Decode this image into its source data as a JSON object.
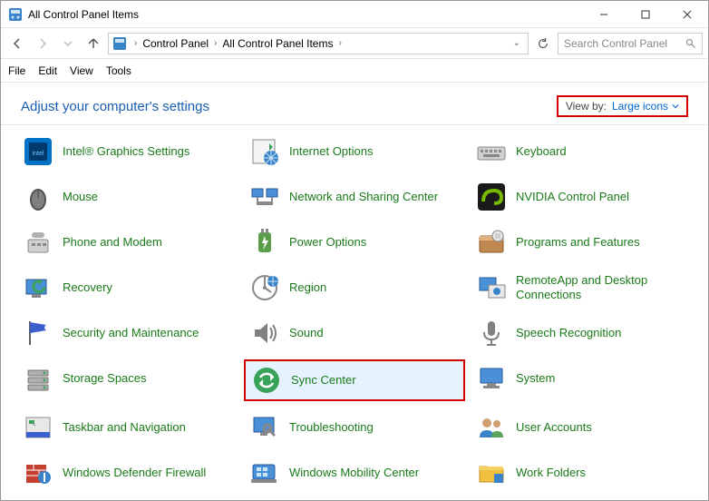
{
  "window": {
    "title": "All Control Panel Items"
  },
  "breadcrumb": {
    "part1": "Control Panel",
    "part2": "All Control Panel Items"
  },
  "search": {
    "placeholder": "Search Control Panel"
  },
  "menus": {
    "file": "File",
    "edit": "Edit",
    "view": "View",
    "tools": "Tools"
  },
  "header": {
    "title": "Adjust your computer's settings"
  },
  "viewby": {
    "label": "View by:",
    "value": "Large icons"
  },
  "items": {
    "intel_graphics": "Intel® Graphics Settings",
    "internet_options": "Internet Options",
    "keyboard": "Keyboard",
    "mouse": "Mouse",
    "network_sharing": "Network and Sharing Center",
    "nvidia": "NVIDIA Control Panel",
    "phone_modem": "Phone and Modem",
    "power_options": "Power Options",
    "programs_features": "Programs and Features",
    "recovery": "Recovery",
    "region": "Region",
    "remoteapp": "RemoteApp and Desktop Connections",
    "security_maintenance": "Security and Maintenance",
    "sound": "Sound",
    "speech_recognition": "Speech Recognition",
    "storage_spaces": "Storage Spaces",
    "sync_center": "Sync Center",
    "system": "System",
    "taskbar_navigation": "Taskbar and Navigation",
    "troubleshooting": "Troubleshooting",
    "user_accounts": "User Accounts",
    "defender_firewall": "Windows Defender Firewall",
    "mobility_center": "Windows Mobility Center",
    "work_folders": "Work Folders"
  }
}
